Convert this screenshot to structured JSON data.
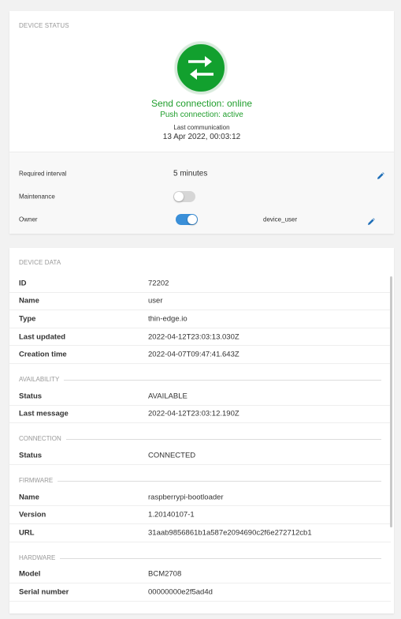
{
  "device_status": {
    "section_title": "DEVICE STATUS",
    "icon": "bidirectional-arrows-icon",
    "send_connection": "Send connection: online",
    "push_connection": "Push connection: active",
    "last_communication_label": "Last communication",
    "last_communication_value": "13 Apr 2022, 00:03:12",
    "required_interval_label": "Required interval",
    "required_interval_value": "5 minutes",
    "maintenance_label": "Maintenance",
    "maintenance_on": false,
    "owner_label": "Owner",
    "owner_toggle_on": true,
    "owner_value": "device_user"
  },
  "device_data": {
    "section_title": "DEVICE DATA",
    "general": [
      {
        "key": "ID",
        "value": "72202"
      },
      {
        "key": "Name",
        "value": "user"
      },
      {
        "key": "Type",
        "value": "thin-edge.io"
      },
      {
        "key": "Last updated",
        "value": "2022-04-12T23:03:13.030Z"
      },
      {
        "key": "Creation time",
        "value": "2022-04-07T09:47:41.643Z"
      }
    ],
    "availability": {
      "title": "AVAILABILITY",
      "rows": [
        {
          "key": "Status",
          "value": "AVAILABLE"
        },
        {
          "key": "Last message",
          "value": "2022-04-12T23:03:12.190Z"
        }
      ]
    },
    "connection": {
      "title": "CONNECTION",
      "rows": [
        {
          "key": "Status",
          "value": "CONNECTED"
        }
      ]
    },
    "firmware": {
      "title": "FIRMWARE",
      "rows": [
        {
          "key": "Name",
          "value": "raspberrypi-bootloader"
        },
        {
          "key": "Version",
          "value": "1.20140107-1"
        },
        {
          "key": "URL",
          "value": "31aab9856861b1a587e2094690c2f6e272712cb1"
        }
      ]
    },
    "hardware": {
      "title": "HARDWARE",
      "rows": [
        {
          "key": "Model",
          "value": "BCM2708"
        },
        {
          "key": "Serial number",
          "value": "00000000e2f5ad4d"
        }
      ]
    }
  },
  "colors": {
    "online_green": "#1f9e2c",
    "icon_green": "#12a02e",
    "toggle_blue": "#3a8fd8",
    "edit_blue": "#1f6fb8"
  }
}
